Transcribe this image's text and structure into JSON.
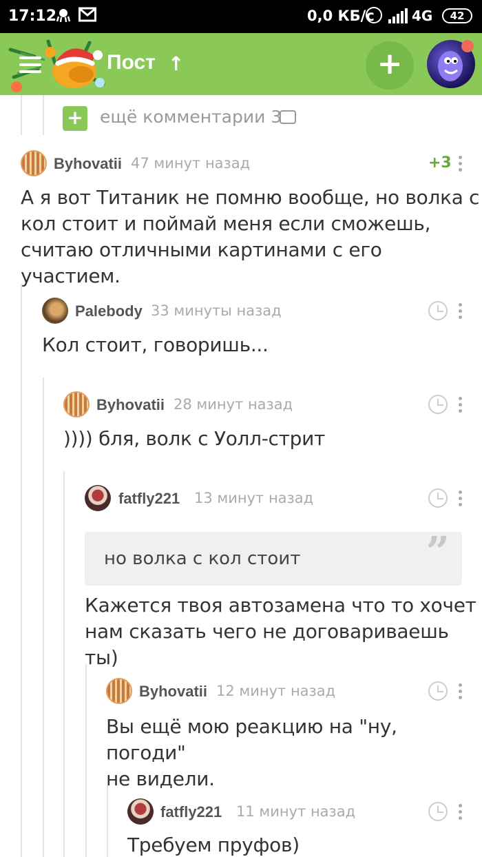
{
  "status_bar": {
    "time": "17:12",
    "network_speed": "0,0 КБ/с",
    "network_type": "4G",
    "battery": "42"
  },
  "header": {
    "title": "Пост",
    "add_label": "+"
  },
  "more_comments": {
    "label": "ещё комментарии 3"
  },
  "comments": [
    {
      "author": "Byhovatii",
      "time": "47 минут назад",
      "rating": "+3",
      "text": [
        "А я вот Титаник не помню вообще, но волка с",
        "кол стоит и поймай меня если сможешь,",
        "считаю отличными картинами с его участием."
      ]
    },
    {
      "author": "Palebody",
      "time": "33 минуты назад",
      "text": [
        "Кол стоит, говоришь..."
      ]
    },
    {
      "author": "Byhovatii",
      "time": "28 минут назад",
      "text": [
        ")))) бля, волк с Уолл-стрит"
      ]
    },
    {
      "author": "fatfly221",
      "time": "13 минут назад",
      "quote": "но волка с кол стоит",
      "text": [
        "Кажется твоя автозамена что то хочет",
        "нам сказать чего не договариваешь ты)"
      ]
    },
    {
      "author": "Byhovatii",
      "time": "12 минут назад",
      "text": [
        "Вы ещё мою реакцию на \"ну, погоди\"",
        "не видели."
      ]
    },
    {
      "author": "fatfly221",
      "time": "11 минут назад",
      "text": [
        "Требуем пруфов)"
      ]
    }
  ],
  "colors": {
    "header_green": "#8ac858",
    "rating_green": "#6aa83e",
    "notification_red": "#f06a5a"
  }
}
